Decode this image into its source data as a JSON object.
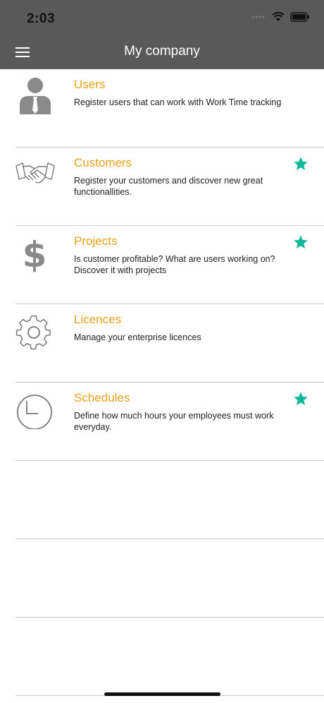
{
  "status_bar": {
    "time": "2:03"
  },
  "nav": {
    "title": "My company",
    "menu_icon": "hamburger-menu-icon"
  },
  "items": [
    {
      "title": "Users",
      "description": "Register users that can work with Work Time tracking",
      "icon": "user-icon",
      "starred": false
    },
    {
      "title": "Customers",
      "description": "Register your customers and discover new great functionallities.",
      "icon": "handshake-icon",
      "starred": true
    },
    {
      "title": "Projects",
      "description": "Is customer profitable? What are users working on? Discover it with projects",
      "icon": "dollar-icon",
      "starred": true
    },
    {
      "title": "Licences",
      "description": "Manage your enterprise licences",
      "icon": "gear-icon",
      "starred": false
    },
    {
      "title": "Schedules",
      "description": "Define how much hours your employees must work everyday.",
      "icon": "clock-icon",
      "starred": true
    }
  ],
  "colors": {
    "accent": "#e8a11a",
    "header": "#595959",
    "star": "#13b79a",
    "icon": "#8a8a8a"
  }
}
